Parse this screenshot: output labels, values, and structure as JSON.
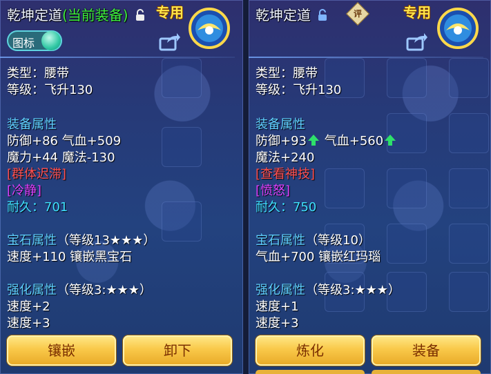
{
  "left": {
    "title": "乾坤定道",
    "equipped_tag": "(当前装备)",
    "special": "专用",
    "toggle_label": "图标",
    "type": "类型：腰带",
    "level": "等级：飞升130",
    "attr_header": "装备属性",
    "attr_line1": "防御+86 气血+509",
    "attr_line2": "魔力+44 魔法-130",
    "skill": "[群体迟滞]",
    "effect": "[冷静]",
    "durability": "耐久：701",
    "gem_header": "宝石属性",
    "gem_level": "（等级13★★★）",
    "gem_line": "速度+110 镶嵌黑宝石",
    "strengthen_header": "强化属性",
    "strengthen_level": "（等级3:★★★）",
    "strengthen_line1": "速度+2",
    "strengthen_line2": "速度+3",
    "button_left": "镶嵌",
    "button_right": "卸下"
  },
  "right": {
    "title": "乾坤定道",
    "review_badge": "评",
    "special": "专用",
    "type": "类型：腰带",
    "level": "等级：飞升130",
    "attr_header": "装备属性",
    "attr_def": "防御+93",
    "attr_hp": "气血+560",
    "attr_line2": "魔法+240",
    "skill": "[查看神技]",
    "effect": "[愤怒]",
    "durability": "耐久：750",
    "gem_header": "宝石属性",
    "gem_level": "（等级10）",
    "gem_line": "气血+700 镶嵌红玛瑙",
    "strengthen_header": "强化属性",
    "strengthen_level": "（等级3:★★★）",
    "strengthen_line1": "速度+1",
    "strengthen_line2": "速度+3",
    "button_left": "炼化",
    "button_right": "装备"
  },
  "colors": {
    "header": "#5fd0ff",
    "skill": "#ff5050",
    "effect": "#e040ff",
    "durability": "#3fe0ff",
    "equipped": "#3ef03e",
    "special": "#ffe64a",
    "button": "#f9c94a",
    "up_arrow": "#2ee06a"
  },
  "icons": {
    "lock": "lock-icon",
    "share": "share-icon",
    "emblem": "special-emblem-icon",
    "up_arrow": "up-arrow-icon"
  }
}
